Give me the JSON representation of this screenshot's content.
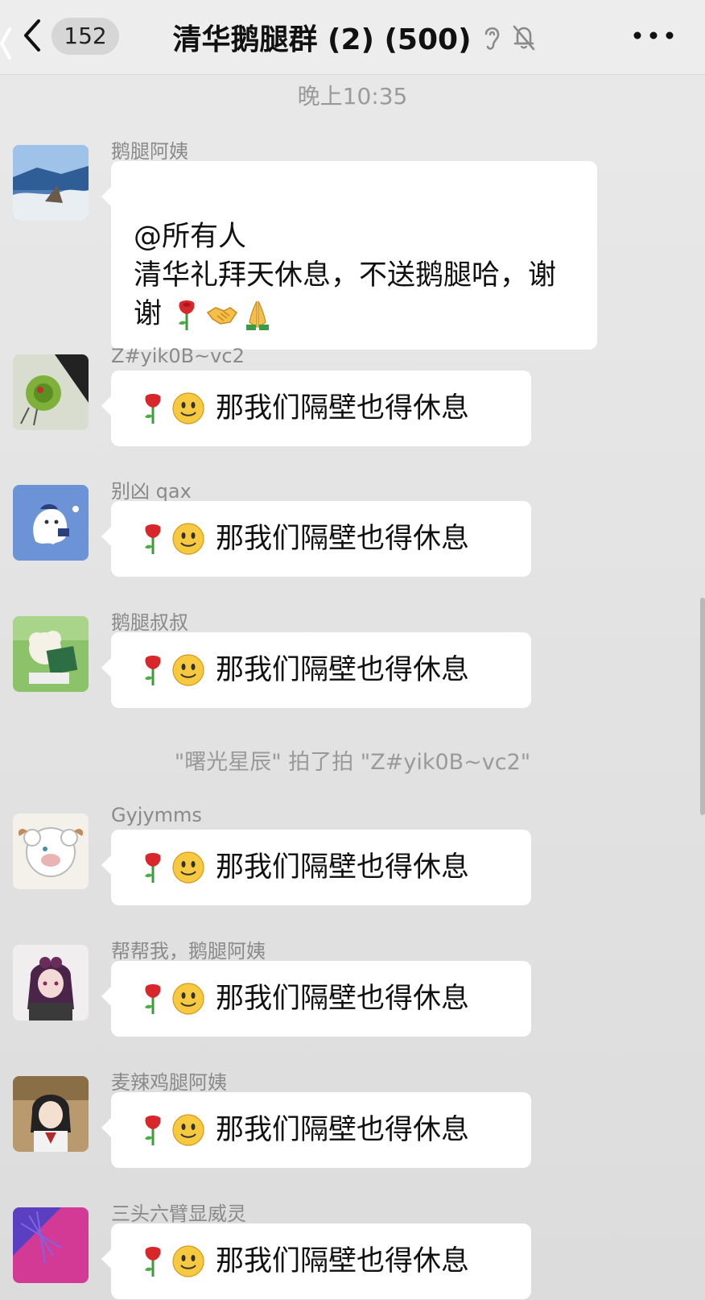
{
  "header": {
    "unread_count": "152",
    "title": "清华鹅腿群 (2) (500)",
    "icons": [
      "back-chevron-icon",
      "ear-icon",
      "mute-bell-icon",
      "more-dots-icon"
    ]
  },
  "time_divider": "晚上10:35",
  "messages": [
    {
      "sender": "鹅腿阿姨",
      "text": "@所有人\n清华礼拜天休息，不送鹅腿哈，谢谢",
      "emojis": [
        "rose",
        "handshake",
        "pray"
      ],
      "avatar": "landscape-avatar"
    },
    {
      "sender": "Z#yik0B~vc2",
      "text": "那我们隔壁也得休息",
      "emojis": [
        "rose",
        "smile"
      ],
      "avatar": "green-plant-avatar"
    },
    {
      "sender": "别凶 qax",
      "text": "那我们隔壁也得休息",
      "emojis": [
        "rose",
        "smile"
      ],
      "avatar": "ghost-avatar"
    },
    {
      "sender": "鹅腿叔叔",
      "text": "那我们隔壁也得休息",
      "emojis": [
        "rose",
        "smile"
      ],
      "avatar": "sheep-book-avatar"
    },
    {
      "sender": "Gyjymms",
      "text": "那我们隔壁也得休息",
      "emojis": [
        "rose",
        "smile"
      ],
      "avatar": "sheep-avatar"
    },
    {
      "sender": "帮帮我，鹅腿阿姨",
      "text": "那我们隔壁也得休息",
      "emojis": [
        "rose",
        "smile"
      ],
      "avatar": "anime-girl-avatar"
    },
    {
      "sender": "麦辣鸡腿阿姨",
      "text": "那我们隔壁也得休息",
      "emojis": [
        "rose",
        "smile"
      ],
      "avatar": "anime-boy-avatar"
    },
    {
      "sender": "三头六臂显威灵",
      "text": "那我们隔壁也得休息",
      "emojis": [
        "rose",
        "smile"
      ],
      "avatar": "pink-art-avatar"
    }
  ],
  "system_message": "\"曙光星辰\" 拍了拍 \"Z#yik0B~vc2\""
}
